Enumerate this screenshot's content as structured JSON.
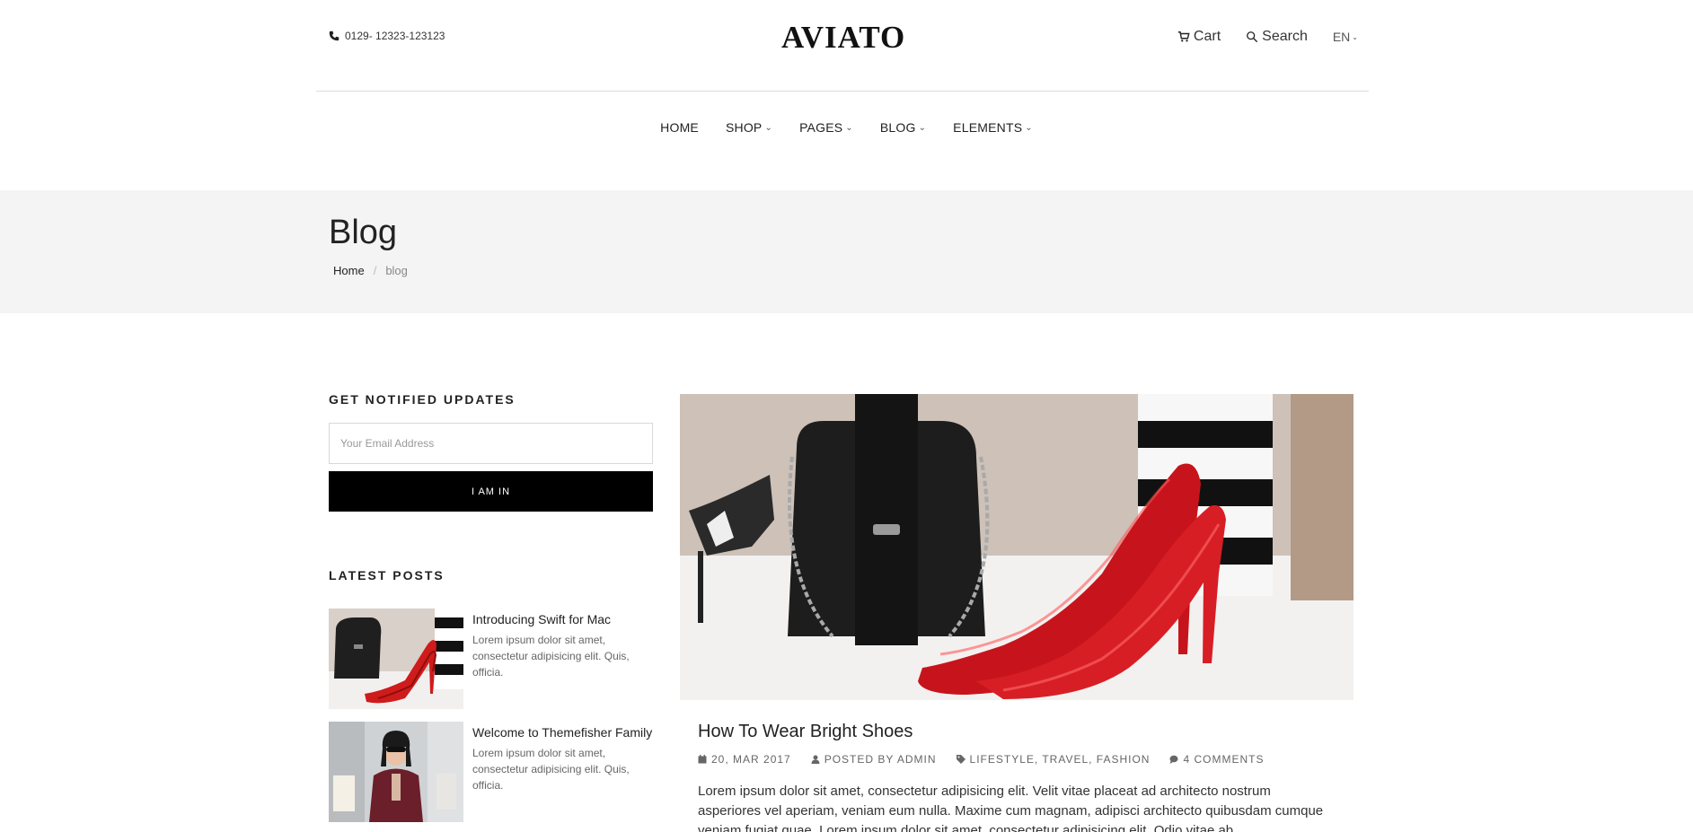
{
  "header": {
    "phone": "0129- 12323-123123",
    "logo": "AVIATO",
    "cart_label": "Cart",
    "search_label": "Search",
    "language": "EN"
  },
  "nav": {
    "items": [
      {
        "label": "HOME",
        "has_dropdown": false
      },
      {
        "label": "SHOP",
        "has_dropdown": true
      },
      {
        "label": "PAGES",
        "has_dropdown": true
      },
      {
        "label": "BLOG",
        "has_dropdown": true
      },
      {
        "label": "ELEMENTS",
        "has_dropdown": true
      }
    ]
  },
  "page_header": {
    "title": "Blog",
    "breadcrumb": {
      "home": "Home",
      "separator": "/",
      "current": "blog"
    }
  },
  "sidebar": {
    "newsletter": {
      "title": "GET NOTIFIED UPDATES",
      "email_placeholder": "Your Email Address",
      "email_value": "",
      "button_label": "I AM IN"
    },
    "latest_posts": {
      "title": "LATEST POSTS",
      "posts": [
        {
          "title": "Introducing Swift for Mac",
          "excerpt": "Lorem ipsum dolor sit amet, consectetur adipisicing elit. Quis, officia."
        },
        {
          "title": "Welcome to Themefisher Family",
          "excerpt": "Lorem ipsum dolor sit amet, consectetur adipisicing elit. Quis, officia."
        }
      ]
    }
  },
  "article": {
    "title": "How To Wear Bright Shoes",
    "date": "20, MAR 2017",
    "author": "POSTED BY ADMIN",
    "categories": "LIFESTYLE, TRAVEL, FASHION",
    "comments": "4 COMMENTS",
    "excerpt": "Lorem ipsum dolor sit amet, consectetur adipisicing elit. Velit vitae placeat ad architecto nostrum asperiores vel aperiam, veniam eum nulla. Maxime cum magnam, adipisci architecto quibusdam cumque veniam fugiat quae. Lorem ipsum dolor sit amet, consectetur adipisicing elit. Odio vitae ab"
  },
  "colors": {
    "page_header_bg": "#f4f4f4",
    "button_bg": "#000000",
    "accent_shoe": "#d11a1a"
  }
}
